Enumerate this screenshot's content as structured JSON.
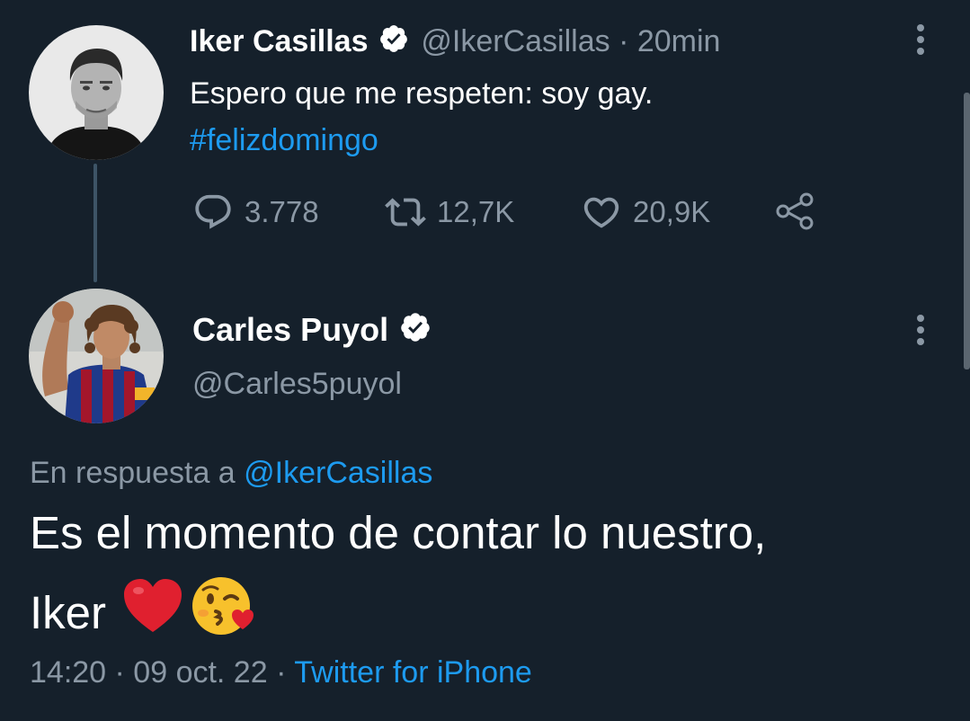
{
  "tweet1": {
    "name": "Iker Casillas",
    "handle": "@IkerCasillas",
    "separator": "·",
    "time": "20min",
    "text": "Espero que me respeten: soy gay.",
    "hashtag": "#felizdomingo",
    "replies": "3.778",
    "retweets": "12,7K",
    "likes": "20,9K"
  },
  "tweet2": {
    "name": "Carles Puyol",
    "handle": "@Carles5puyol",
    "reply_prefix": "En respuesta a",
    "reply_to": "@IkerCasillas",
    "text_line1": "Es el momento de contar lo nuestro,",
    "text_line2": "Iker",
    "emojis": [
      "red-heart",
      "face-blowing-a-kiss"
    ],
    "timestamp": "14:20 · 09 oct. 22",
    "separator": "·",
    "source": "Twitter for iPhone"
  },
  "colors": {
    "background": "#15202b",
    "link": "#1d9bf0",
    "secondary_text": "#8b98a5"
  }
}
